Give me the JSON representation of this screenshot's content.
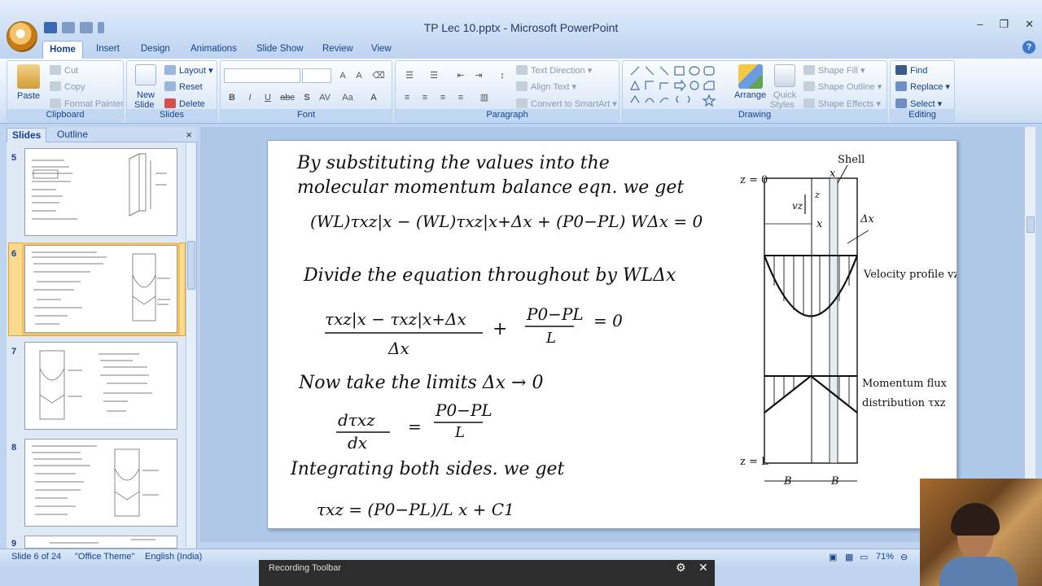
{
  "window": {
    "title": "TP Lec 10.pptx - Microsoft PowerPoint",
    "controls": [
      "–",
      "❐",
      "✕"
    ]
  },
  "ribbon_tabs": [
    "Home",
    "Insert",
    "Design",
    "Animations",
    "Slide Show",
    "Review",
    "View"
  ],
  "clipboard": {
    "paste": "Paste",
    "cut": "Cut",
    "copy": "Copy",
    "format_painter": "Format Painter",
    "label": "Clipboard"
  },
  "slides_group": {
    "new_slide_1": "New",
    "new_slide_2": "Slide",
    "layout": "Layout",
    "reset": "Reset",
    "delete": "Delete",
    "label": "Slides"
  },
  "font_group": {
    "label": "Font",
    "bold": "B",
    "italic": "I",
    "underline": "U",
    "strike": "abc",
    "shadow": "S"
  },
  "paragraph_group": {
    "text_direction": "Text Direction",
    "align_text": "Align Text",
    "convert_smartart": "Convert to SmartArt",
    "label": "Paragraph"
  },
  "drawing_group": {
    "arrange": "Arrange",
    "quick_styles_1": "Quick",
    "quick_styles_2": "Styles",
    "shape_fill": "Shape Fill",
    "shape_outline": "Shape Outline",
    "shape_effects": "Shape Effects",
    "label": "Drawing"
  },
  "editing_group": {
    "find": "Find",
    "replace": "Replace",
    "select": "Select",
    "label": "Editing"
  },
  "panel": {
    "tabs": [
      "Slides",
      "Outline"
    ],
    "close": "×",
    "slide_numbers": [
      "5",
      "6",
      "7",
      "8",
      "9"
    ],
    "selected": "6"
  },
  "slide": {
    "handwriting": {
      "line1": "By substituting the values into the",
      "line2": "molecular momentum balance eqn. we get",
      "eq1": "(WL)τxz|x − (WL)τxz|x+Δx + (P0−PL) WΔx = 0",
      "line3": "Divide the equation throughout by WLΔx",
      "eq2_num": "τxz|x − τxz|x+Δx",
      "eq2_den": "Δx",
      "eq2_rest_num": "P0−PL",
      "eq2_rest_den": "L",
      "eq2_rhs": "= 0",
      "line4": "Now take the limits Δx → 0",
      "eq3_num": "dτxz",
      "eq3_den": "dx",
      "eq3_rhs_num": "P0−PL",
      "eq3_rhs_den": "L",
      "line5": "Integrating both sides. we get",
      "eq4": "τxz = (P0−PL)/L x + C1"
    },
    "figure": {
      "shell": "Shell",
      "z0": "z = 0",
      "zL": "z = L",
      "x_top": "x",
      "vz": "vz",
      "z_axis": "z",
      "x_mid": "x",
      "dx": "Δx",
      "velocity_profile": "Velocity profile vz(x)",
      "momentum_flux_1": "Momentum flux",
      "momentum_flux_2": "distribution τxz",
      "B_left": "B",
      "B_right": "B"
    }
  },
  "statusbar": {
    "slide_of": "Slide 6 of 24",
    "theme": "\"Office Theme\"",
    "language": "English (India)",
    "zoom": "71%"
  },
  "recording_toolbar": {
    "title": "Recording Toolbar"
  }
}
